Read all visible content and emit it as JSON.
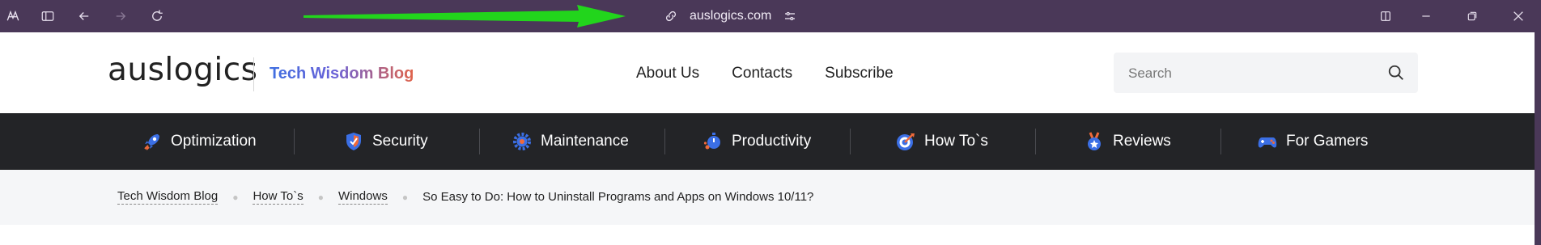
{
  "browser": {
    "url": "auslogics.com",
    "arrow_color": "#22d51c",
    "icons": [
      "app-logo-icon",
      "sidebar-toggle-icon",
      "back-icon",
      "forward-icon",
      "reload-icon",
      "link-icon",
      "site-settings-icon",
      "split-view-icon",
      "minimize-icon",
      "restore-icon",
      "close-icon"
    ]
  },
  "header": {
    "logo": "auslogics",
    "blog_name": "Tech Wisdom Blog",
    "nav": [
      "About Us",
      "Contacts",
      "Subscribe"
    ],
    "search_placeholder": "Search"
  },
  "categories": [
    {
      "label": "Optimization",
      "icon": "rocket-icon"
    },
    {
      "label": "Security",
      "icon": "shield-icon"
    },
    {
      "label": "Maintenance",
      "icon": "gear-icon"
    },
    {
      "label": "Productivity",
      "icon": "stopwatch-icon"
    },
    {
      "label": "How To`s",
      "icon": "target-icon"
    },
    {
      "label": "Reviews",
      "icon": "medal-icon"
    },
    {
      "label": "For Gamers",
      "icon": "gamepad-icon"
    }
  ],
  "breadcrumb": {
    "items": [
      "Tech Wisdom Blog",
      "How To`s",
      "Windows"
    ],
    "current": "So Easy to Do: How to Uninstall Programs and Apps on Windows 10/11?"
  }
}
